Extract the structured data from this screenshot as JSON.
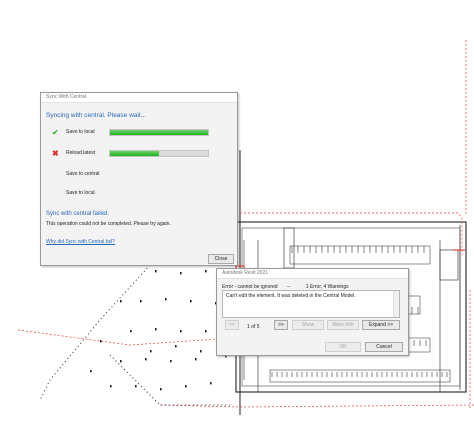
{
  "sync_dialog": {
    "title": "Sync With Central",
    "heading": "Syncing with central. Please wait...",
    "steps": [
      {
        "label": "Save to local",
        "icon": "check-icon",
        "progress": 1.0
      },
      {
        "label": "Reload latest",
        "icon": "error-x-icon",
        "progress": 0.5
      },
      {
        "label": "Save to central"
      },
      {
        "label": "Save to local"
      }
    ],
    "failed_text": "Sync with central failed.",
    "operation_text": "This operation could not be completed. Please try again.",
    "help_link": "Why did Sync with Central fail?",
    "close_label": "Close"
  },
  "error_dialog": {
    "title": "Autodesk Revit 2021",
    "severity": "Error - cannot be ignored",
    "separator": "--",
    "count": "1 Error, 4 Warnings",
    "message": "Can't edit the element.  It was deleted in the Central Model.",
    "prev_label": "<<",
    "page_info": "1 of 5",
    "next_label": ">>",
    "show_label": "Show",
    "more_info_label": "More Info",
    "expand_label": "Expand >>",
    "ok_label": "OK",
    "cancel_label": "Cancel"
  },
  "colors": {
    "accent_blue": "#2867b9",
    "progress_green": "#1fb11d",
    "error_red": "#d9332b",
    "drawing_red": "#e0443e"
  }
}
